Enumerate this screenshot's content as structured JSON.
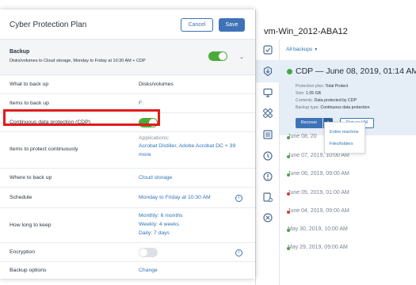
{
  "vm": {
    "title": "vm-Win_2012-ABA12",
    "backups_filter": "All backups",
    "cdp_backup": {
      "heading": "CDP — June 08, 2019, 01:14 AM",
      "details": [
        {
          "label": "Protection plan:",
          "value": "Total Protect"
        },
        {
          "label": "Size:",
          "value": "1.05 GB"
        },
        {
          "label": "Contents:",
          "value": "Data protected by CDP"
        },
        {
          "label": "Backup type:",
          "value": "Continuous data protection"
        }
      ],
      "recover_label": "Recover",
      "caret": "▴",
      "run_vm_label": "Run as VM"
    },
    "recover_menu": [
      "Entire machine",
      "Files/folders"
    ],
    "backups": [
      {
        "label": "June 08, 20",
        "status": "ok"
      },
      {
        "label": "June 07, 2019, 10:00 AM",
        "status": "ok"
      },
      {
        "label": "June 06, 2019, 09:00 AM",
        "status": "ok"
      },
      {
        "label": "June 05, 2019, 01:00 AM",
        "status": "error"
      },
      {
        "label": "June 04, 2019, 09:00 AM",
        "status": "error"
      },
      {
        "label": "May 30, 2019, 10:00 AM",
        "status": "ok"
      },
      {
        "label": "May 29, 2019, 09:00 AM",
        "status": "ok"
      }
    ],
    "rail_icons": [
      "shield-check-icon",
      "backup-icon",
      "monitor-icon",
      "puzzle-icon",
      "list-icon",
      "clock-icon",
      "alert-icon",
      "device-settings-icon",
      "close-circle-icon"
    ]
  },
  "plan": {
    "title": "Cyber Protection Plan",
    "cancel_label": "Cancel",
    "save_label": "Save",
    "backup": {
      "label": "Backup",
      "description": "Disks/volumes to Cloud storage, Monday to Friday at 10:30 AM + CDP",
      "enabled": true
    },
    "rows": {
      "what_to_back_up": {
        "label": "What to back up",
        "value": "Disks/volumes"
      },
      "items_to_back_up": {
        "label": "Items to back up",
        "value": "F:"
      },
      "cdp": {
        "label": "Continuous data protection (CDP)",
        "enabled": true
      },
      "items_continuous": {
        "label": "Items to protect continuously",
        "heading": "Applications:",
        "value_line1": "Acrobat Distiller, Adobe Acrobat DC + 39",
        "value_line2": "more"
      },
      "where": {
        "label": "Where to back up",
        "value": "Cloud storage"
      },
      "schedule": {
        "label": "Schedule",
        "value": "Monday to Friday at 10:30 AM"
      },
      "how_long": {
        "label": "How long to keep",
        "lines": [
          "Monthly: 6 months",
          "Weekly: 4 weeks",
          "Daily: 7 days"
        ]
      },
      "encryption": {
        "label": "Encryption",
        "enabled": false
      },
      "backup_options": {
        "label": "Backup options",
        "value": "Change"
      }
    },
    "info_glyph": "i"
  },
  "colors": {
    "accent": "#3f73b8",
    "toggle_on": "#4aab3a",
    "ok_dot": "#45a845",
    "error_dot": "#d9342b",
    "highlight": "#e21b1b"
  }
}
